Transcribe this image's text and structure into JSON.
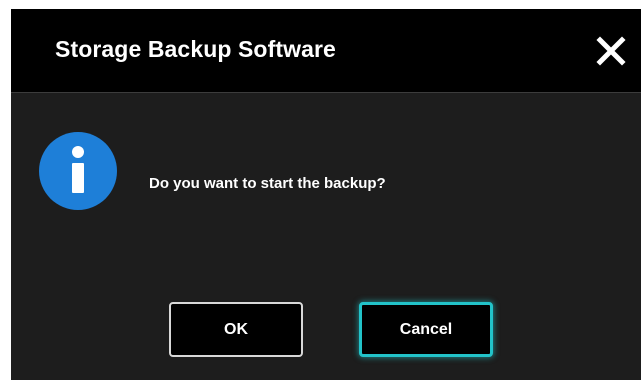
{
  "dialog": {
    "title": "Storage Backup Software",
    "message": "Do you want to start the backup?",
    "ok_label": "OK",
    "cancel_label": "Cancel",
    "icons": {
      "close": "close-icon",
      "info": "info-icon"
    },
    "colors": {
      "titlebar": "#000000",
      "body": "#1d1d1d",
      "info_icon": "#1e7fd8",
      "focus_accent": "#22c3c9",
      "text": "#ffffff"
    }
  }
}
